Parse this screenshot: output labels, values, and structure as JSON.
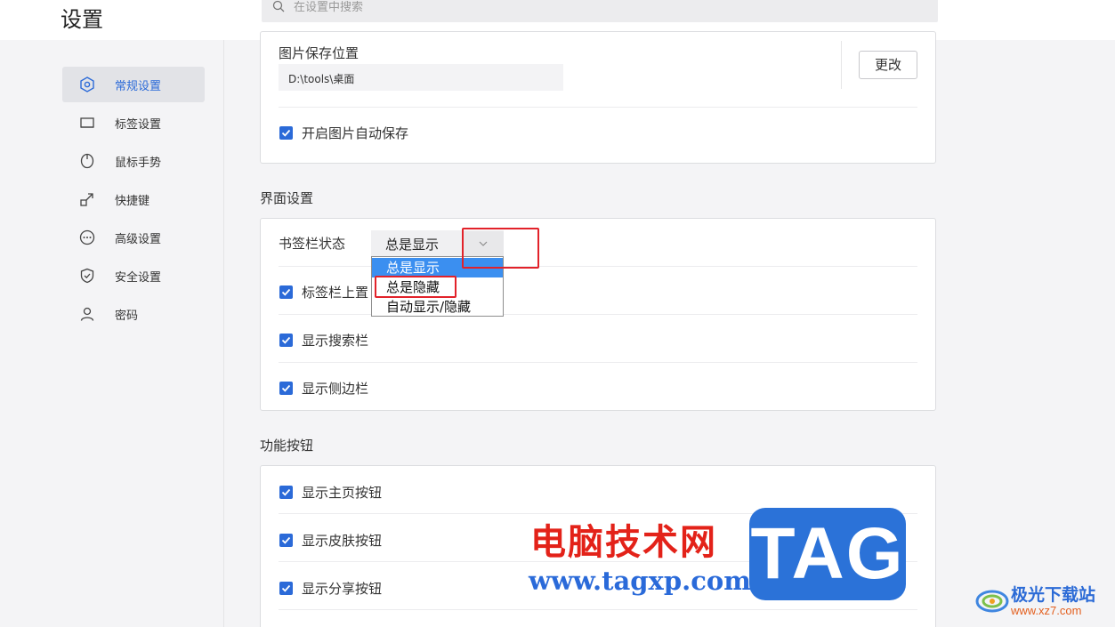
{
  "header": {
    "title": "设置",
    "search_placeholder": "在设置中搜索"
  },
  "sidebar": {
    "items": [
      {
        "label": "常规设置",
        "icon": "gear-hexagon-icon",
        "active": true
      },
      {
        "label": "标签设置",
        "icon": "tab-icon",
        "active": false
      },
      {
        "label": "鼠标手势",
        "icon": "mouse-icon",
        "active": false
      },
      {
        "label": "快捷键",
        "icon": "shortcut-arrow-icon",
        "active": false
      },
      {
        "label": "高级设置",
        "icon": "more-circle-icon",
        "active": false
      },
      {
        "label": "安全设置",
        "icon": "shield-check-icon",
        "active": false
      },
      {
        "label": "密码",
        "icon": "user-icon",
        "active": false
      }
    ]
  },
  "image_save": {
    "label": "图片保存位置",
    "path": "D:\\tools\\桌面",
    "change_button": "更改",
    "auto_save_label": "开启图片自动保存",
    "auto_save_checked": true
  },
  "interface": {
    "section_title": "界面设置",
    "bookmark_bar_label": "书签栏状态",
    "bookmark_bar_value": "总是显示",
    "dropdown_options": [
      "总是显示",
      "总是隐藏",
      "自动显示/隐藏"
    ],
    "dropdown_highlighted_index": 0,
    "checkboxes": [
      {
        "label": "标签栏上置",
        "checked": true
      },
      {
        "label": "显示搜索栏",
        "checked": true
      },
      {
        "label": "显示侧边栏",
        "checked": true
      }
    ]
  },
  "function_buttons": {
    "section_title": "功能按钮",
    "checkboxes": [
      {
        "label": "显示主页按钮",
        "checked": true
      },
      {
        "label": "显示皮肤按钮",
        "checked": true
      },
      {
        "label": "显示分享按钮",
        "checked": true
      }
    ]
  },
  "watermark": {
    "cn_text": "电脑技术网",
    "url": "www.tagxp.com",
    "tag": "TAG",
    "site_name": "极光下载站",
    "site_url": "www.xz7.com"
  },
  "colors": {
    "accent": "#2b6ad8",
    "highlight": "#3b8ff0",
    "annotation_red": "#e2222a"
  }
}
